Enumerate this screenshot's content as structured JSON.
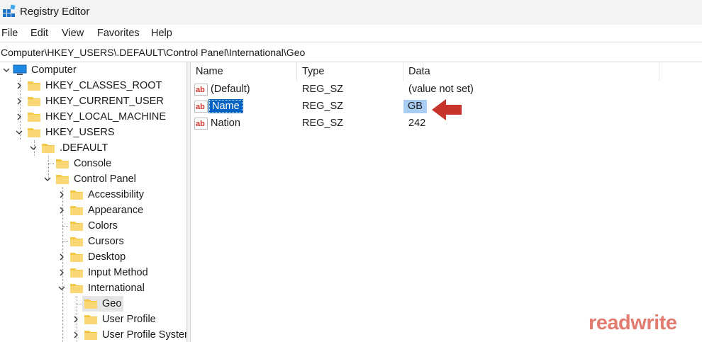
{
  "window": {
    "title": "Registry Editor"
  },
  "menu": {
    "file": "File",
    "edit": "Edit",
    "view": "View",
    "favorites": "Favorites",
    "help": "Help"
  },
  "address": "Computer\\HKEY_USERS\\.DEFAULT\\Control Panel\\International\\Geo",
  "tree": {
    "computer": "Computer",
    "hkcr": "HKEY_CLASSES_ROOT",
    "hkcu": "HKEY_CURRENT_USER",
    "hklm": "HKEY_LOCAL_MACHINE",
    "hku": "HKEY_USERS",
    "default": ".DEFAULT",
    "console": "Console",
    "control_panel": "Control Panel",
    "accessibility": "Accessibility",
    "appearance": "Appearance",
    "colors": "Colors",
    "cursors": "Cursors",
    "desktop": "Desktop",
    "input_method": "Input Method",
    "international": "International",
    "geo": "Geo",
    "user_profile": "User Profile",
    "user_profile_system": "User Profile Syster"
  },
  "list": {
    "headers": {
      "name": "Name",
      "type": "Type",
      "data": "Data"
    },
    "rows": [
      {
        "name": "(Default)",
        "type": "REG_SZ",
        "data": "(value not set)"
      },
      {
        "name": "Name",
        "type": "REG_SZ",
        "data": "GB"
      },
      {
        "name": "Nation",
        "type": "REG_SZ",
        "data": "242"
      }
    ]
  },
  "watermark": "readwrite",
  "colors": {
    "selection": "#0063c4",
    "data_highlight": "#a9cdf3",
    "arrow": "#c8332b",
    "watermark": "#e27c70",
    "folder": "#f3c644"
  }
}
